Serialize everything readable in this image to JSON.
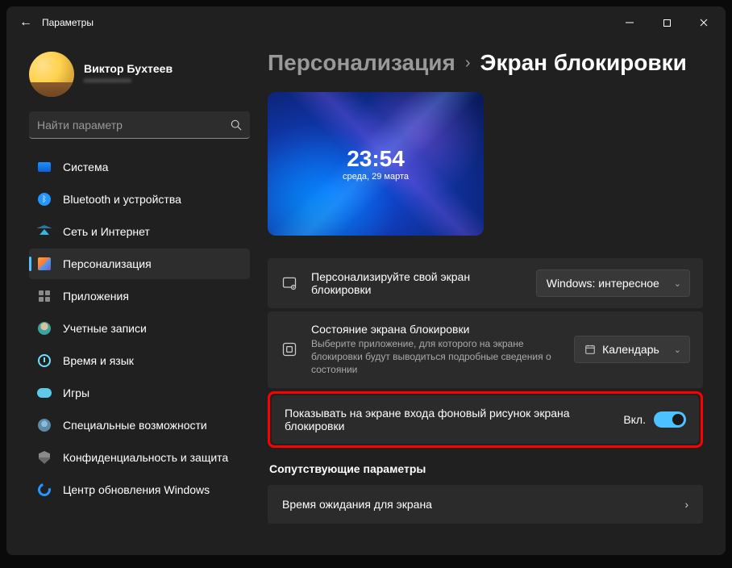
{
  "window": {
    "title": "Параметры"
  },
  "profile": {
    "name": "Виктор Бухтеев",
    "email": "••••••••••••••"
  },
  "search": {
    "placeholder": "Найти параметр"
  },
  "nav": {
    "items": [
      {
        "label": "Система",
        "icon": "system"
      },
      {
        "label": "Bluetooth и устройства",
        "icon": "bluetooth"
      },
      {
        "label": "Сеть и Интернет",
        "icon": "network"
      },
      {
        "label": "Персонализация",
        "icon": "personalization",
        "active": true
      },
      {
        "label": "Приложения",
        "icon": "apps"
      },
      {
        "label": "Учетные записи",
        "icon": "accounts"
      },
      {
        "label": "Время и язык",
        "icon": "time"
      },
      {
        "label": "Игры",
        "icon": "gaming"
      },
      {
        "label": "Специальные возможности",
        "icon": "accessibility"
      },
      {
        "label": "Конфиденциальность и защита",
        "icon": "privacy"
      },
      {
        "label": "Центр обновления Windows",
        "icon": "update"
      }
    ]
  },
  "breadcrumbs": {
    "parent": "Персонализация",
    "current": "Экран блокировки"
  },
  "preview": {
    "time": "23:54",
    "date": "среда, 29 марта"
  },
  "cards": {
    "personalize": {
      "title": "Персонализируйте свой экран блокировки",
      "dropdown": "Windows: интересное"
    },
    "status": {
      "title": "Состояние экрана блокировки",
      "subtitle": "Выберите приложение, для которого на экране блокировки будут выводиться подробные сведения о состоянии",
      "dropdown": "Календарь"
    },
    "signin_bg": {
      "title": "Показывать на экране входа фоновый рисунок экрана блокировки",
      "state": "Вкл."
    }
  },
  "related": {
    "heading": "Сопутствующие параметры",
    "timeout": "Время ожидания для экрана"
  }
}
